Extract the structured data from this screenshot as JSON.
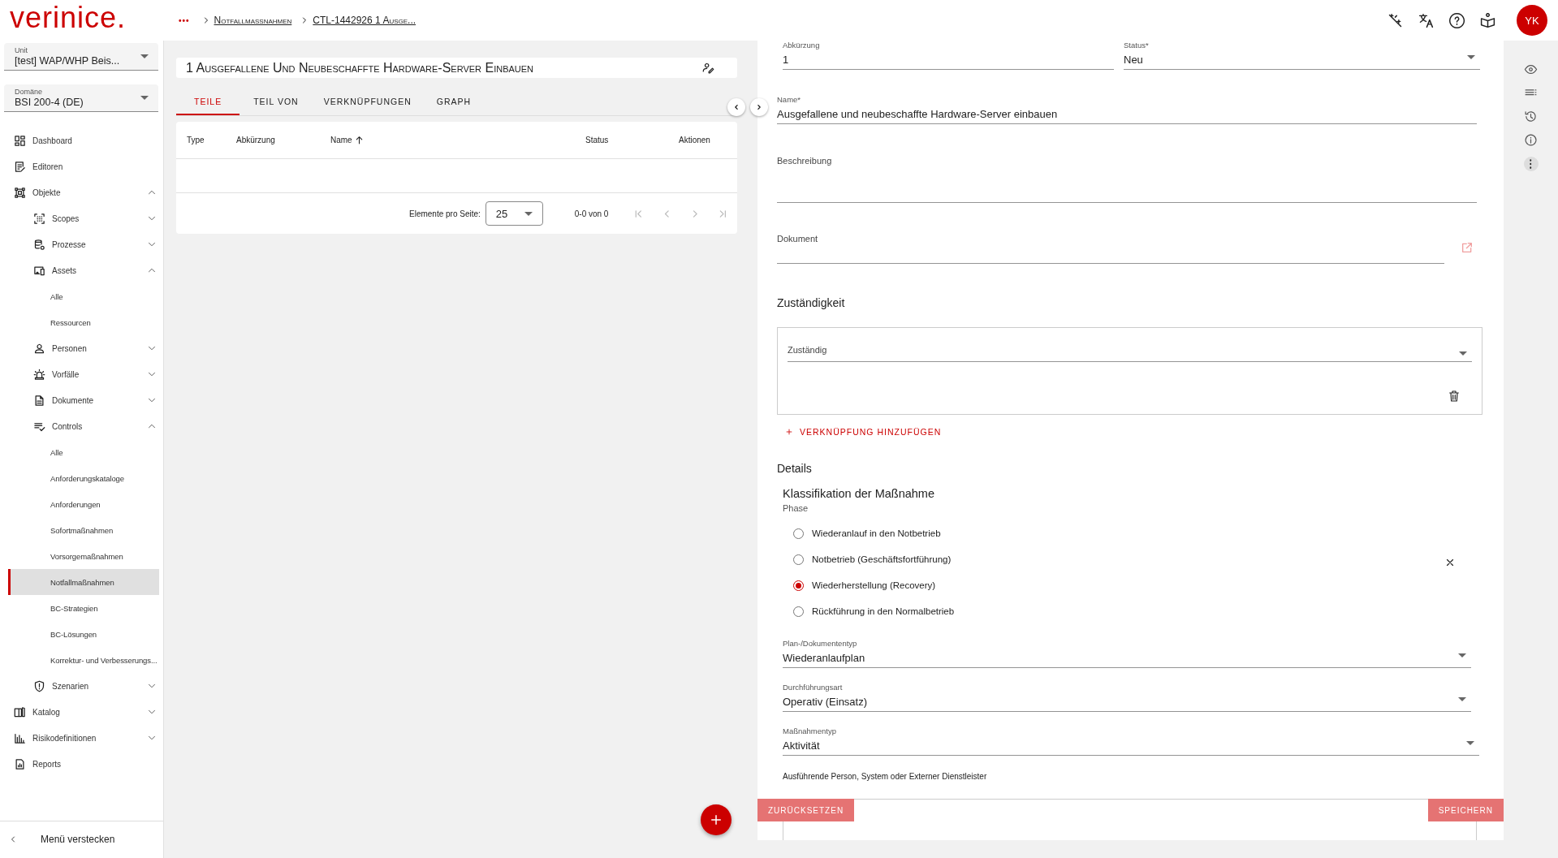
{
  "header": {
    "logo": "verinice.",
    "breadcrumb": [
      {
        "kind": "more",
        "label": "•••"
      },
      {
        "kind": "link",
        "label": "Notfallmaßnahmen"
      },
      {
        "kind": "link",
        "label": "CTL-1442926 1 Ausge..."
      }
    ],
    "avatar": "YK"
  },
  "sidebar": {
    "selects": [
      {
        "label": "Unit",
        "value": "[test] WAP/WHP Beis..."
      },
      {
        "label": "Domäne",
        "value": "BSI 200-4 (DE)"
      }
    ],
    "nav": [
      {
        "kind": "dashboard",
        "label": "Dashboard",
        "selected": false
      },
      {
        "kind": "editor",
        "label": "Editoren",
        "selected": false
      },
      {
        "kind": "objects",
        "label": "Objekte",
        "selected": false,
        "expanded": true,
        "children": [
          {
            "kind": "scopes",
            "label": "Scopes",
            "selected": false,
            "expanded": false
          },
          {
            "kind": "processes",
            "label": "Prozesse",
            "selected": false,
            "expanded": false
          },
          {
            "kind": "assets",
            "label": "Assets",
            "selected": false,
            "expanded": true,
            "children": [
              {
                "label": "Alle",
                "selected": false
              },
              {
                "label": "Ressourcen",
                "selected": false
              }
            ]
          },
          {
            "kind": "persons",
            "label": "Personen",
            "selected": false,
            "expanded": false
          },
          {
            "kind": "incidents",
            "label": "Vorfälle",
            "selected": false,
            "expanded": false
          },
          {
            "kind": "documents",
            "label": "Dokumente",
            "selected": false,
            "expanded": false
          },
          {
            "kind": "controls",
            "label": "Controls",
            "selected": false,
            "expanded": true,
            "children": [
              {
                "label": "Alle",
                "selected": false
              },
              {
                "label": "Anforderungskataloge",
                "selected": false
              },
              {
                "label": "Anforderungen",
                "selected": false
              },
              {
                "label": "Sofortmaßnahmen",
                "selected": false
              },
              {
                "label": "Vorsorgemaßnahmen",
                "selected": false
              },
              {
                "label": "Notfallmaßnahmen",
                "selected": true
              },
              {
                "label": "BC-Strategien",
                "selected": false
              },
              {
                "label": "BC-Lösungen",
                "selected": false
              },
              {
                "label": "Korrektur- und Verbesserungs...",
                "selected": false
              }
            ]
          },
          {
            "kind": "scenarios",
            "label": "Szenarien",
            "selected": false,
            "expanded": false
          }
        ]
      },
      {
        "kind": "catalog",
        "label": "Katalog",
        "selected": false,
        "expanded": false
      },
      {
        "kind": "risk",
        "label": "Risikodefinitionen",
        "selected": false,
        "expanded": false
      },
      {
        "kind": "reports",
        "label": "Reports",
        "selected": false
      }
    ],
    "footer": "Menü verstecken"
  },
  "detail": {
    "title": "1 Ausgefallene Und Neubeschaffte Hardware-Server Einbauen",
    "tabs": [
      {
        "label": "TEILE",
        "selected": true
      },
      {
        "label": "TEIL VON",
        "selected": false
      },
      {
        "label": "VERKNÜPFUNGEN",
        "selected": false
      },
      {
        "label": "GRAPH",
        "selected": false
      }
    ],
    "table": {
      "columns": [
        {
          "label": "Type"
        },
        {
          "label": "Abkürzung"
        },
        {
          "label": "Name",
          "sorted": true
        },
        {
          "label": "Status"
        },
        {
          "label": "Aktionen"
        }
      ]
    },
    "pagination": {
      "label": "Elemente pro Seite:",
      "page_size": "25",
      "range": "0-0 von 0"
    }
  },
  "form": {
    "abbreviation": {
      "label": "Abkürzung",
      "value": "1"
    },
    "status": {
      "label": "Status*",
      "value": "Neu"
    },
    "name": {
      "label": "Name*",
      "value": "Ausgefallene und neubeschaffte Hardware-Server einbauen"
    },
    "description": {
      "label": "Beschreibung"
    },
    "document": {
      "label": "Dokument"
    },
    "responsibility": {
      "heading": "Zuständigkeit",
      "field_label": "Zuständig",
      "add_link": "VERKNÜPFUNG HINZUFÜGEN"
    },
    "details": {
      "heading": "Details",
      "group": "Klassifikation der Maßnahme",
      "phase_label": "Phase",
      "phases": [
        {
          "label": "Wiederanlauf in den Notbetrieb",
          "selected": false
        },
        {
          "label": "Notbetrieb (Geschäftsfortführung)",
          "selected": false
        },
        {
          "label": "Wiederherstellung (Recovery)",
          "selected": true
        },
        {
          "label": "Rückführung in den Normalbetrieb",
          "selected": false
        }
      ],
      "selects": [
        {
          "label": "Plan-/Dokumententyp",
          "value": "Wiederanlaufplan"
        },
        {
          "label": "Durchführungsart",
          "value": "Operativ (Einsatz)"
        },
        {
          "label": "Maßnahmentyp",
          "value": "Aktivität"
        }
      ],
      "executor_label": "Ausführende Person, System oder Externer Dienstleister"
    },
    "buttons": [
      {
        "kind": "reset",
        "label": "ZURÜCKSETZEN",
        "disabled": true
      },
      {
        "kind": "save",
        "label": "SPEICHERN",
        "disabled": true
      }
    ]
  }
}
